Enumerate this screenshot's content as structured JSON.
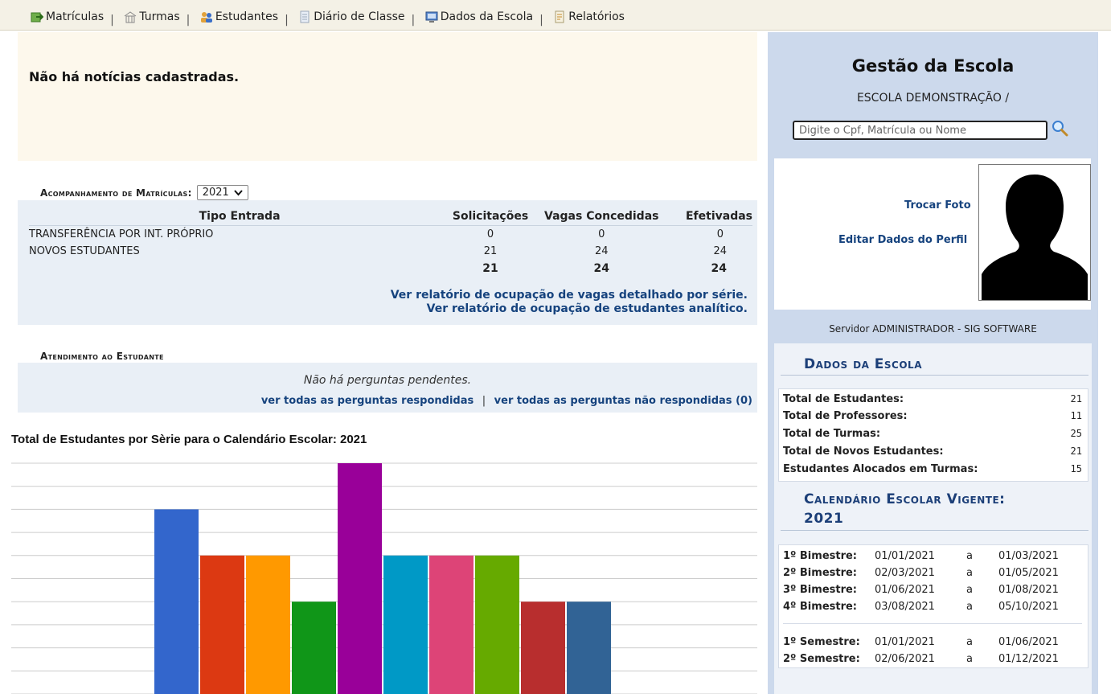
{
  "menu": {
    "items": [
      {
        "label": "Matrículas",
        "icon": "enroll-icon"
      },
      {
        "label": "Turmas",
        "icon": "classes-icon"
      },
      {
        "label": "Estudantes",
        "icon": "students-icon"
      },
      {
        "label": "Diário de Classe",
        "icon": "class-diary-icon"
      },
      {
        "label": "Dados da Escola",
        "icon": "school-data-icon"
      },
      {
        "label": "Relatórios",
        "icon": "reports-icon"
      }
    ],
    "separator": "|"
  },
  "news": {
    "text": "Não há notícias cadastradas."
  },
  "enrollment": {
    "title": "Acompanhamento de Matrículas:",
    "year": "2021",
    "headers": [
      "Tipo Entrada",
      "Solicitações",
      "Vagas Concedidas",
      "Efetivadas"
    ],
    "rows": [
      {
        "tipo": "TRANSFERÊNCIA POR INT. PRÓPRIO",
        "sol": "0",
        "vagas": "0",
        "efet": "0"
      },
      {
        "tipo": "NOVOS ESTUDANTES",
        "sol": "21",
        "vagas": "24",
        "efet": "24"
      }
    ],
    "totals": {
      "sol": "21",
      "vagas": "24",
      "efet": "24"
    },
    "link_detail": "Ver relatório de ocupação de vagas detalhado por série.",
    "link_analytic": "Ver relatório de ocupação de estudantes analítico."
  },
  "attendance": {
    "title": "Atendimento ao Estudante",
    "no_pending": "Não há perguntas pendentes.",
    "link_answered": "ver todas as perguntas respondidas",
    "separator": "|",
    "link_unanswered": "ver todas as perguntas não respondidas (0)"
  },
  "chart_data": {
    "type": "bar",
    "title": "Total de Estudantes por Sèrie para o Calendário Escolar: 2021",
    "categories": [
      "",
      "",
      "",
      "",
      "",
      "",
      "",
      "",
      "",
      ""
    ],
    "values": [
      4,
      3,
      3,
      2,
      5,
      3,
      3,
      3,
      2,
      2
    ],
    "colors": [
      "#3366cc",
      "#dc3912",
      "#ff9900",
      "#109618",
      "#990099",
      "#0099c6",
      "#dd4477",
      "#66aa00",
      "#b82e2e",
      "#316395"
    ],
    "ylim": [
      0,
      5
    ],
    "grid": true
  },
  "sidebar": {
    "title": "Gestão da Escola",
    "school": "ESCOLA DEMONSTRAÇÃO /",
    "search_placeholder": "Digite o Cpf, Matrícula ou Nome",
    "change_photo": "Trocar Foto",
    "edit_profile": "Editar Dados do Perfil",
    "server": "Servidor ADMINISTRADOR - SIG SOFTWARE",
    "school_data_title": "Dados da Escola",
    "stats": [
      {
        "label": "Total de Estudantes:",
        "value": "21"
      },
      {
        "label": "Total de Professores:",
        "value": "11"
      },
      {
        "label": "Total de Turmas:",
        "value": "25"
      },
      {
        "label": "Total de Novos Estudantes:",
        "value": "21"
      },
      {
        "label": "Estudantes Alocados em Turmas:",
        "value": "15"
      }
    ],
    "calendar_title_1": "Calendário Escolar Vigente:",
    "calendar_title_2": "2021",
    "periods": [
      {
        "name": "1º Bimestre:",
        "start": "01/01/2021",
        "a": "a",
        "end": "01/03/2021"
      },
      {
        "name": "2º Bimestre:",
        "start": "02/03/2021",
        "a": "a",
        "end": "01/05/2021"
      },
      {
        "name": "3º Bimestre:",
        "start": "01/06/2021",
        "a": "a",
        "end": "01/08/2021"
      },
      {
        "name": "4º Bimestre:",
        "start": "03/08/2021",
        "a": "a",
        "end": "05/10/2021"
      },
      {
        "name": "1º Semestre:",
        "start": "01/01/2021",
        "a": "a",
        "end": "01/06/2021"
      },
      {
        "name": "2º Semestre:",
        "start": "02/06/2021",
        "a": "a",
        "end": "01/12/2021"
      }
    ]
  }
}
